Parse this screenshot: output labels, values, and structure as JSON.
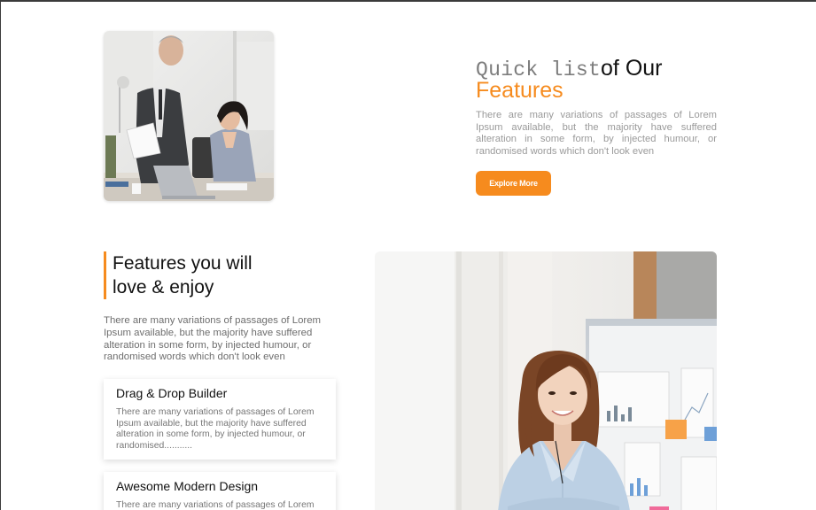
{
  "hero": {
    "title_part1": "Quick list",
    "title_part2": "of Our",
    "title_highlight": "Features",
    "description": "There are many variations of passages of Lorem Ipsum available, but the majority have suffered alteration in some form, by injected humour, or randomised words which don't look even",
    "button_label": "Explore More"
  },
  "features": {
    "heading": "Features you will love & enjoy",
    "description": "There are many variations of passages of Lorem Ipsum available, but the majority have suffered alteration in some form, by injected humour, or randomised words which don't look even",
    "cards": [
      {
        "title": "Drag & Drop Builder",
        "text": "There are many variations of passages of Lorem Ipsum available, but the majority have suffered alteration in some form, by injected humour, or randomised..........."
      },
      {
        "title": "Awesome Modern Design",
        "text": "There are many variations of passages of Lorem"
      }
    ]
  },
  "colors": {
    "accent": "#f68b1e",
    "heading": "#111111",
    "muted_text": "#9a9a9a"
  }
}
